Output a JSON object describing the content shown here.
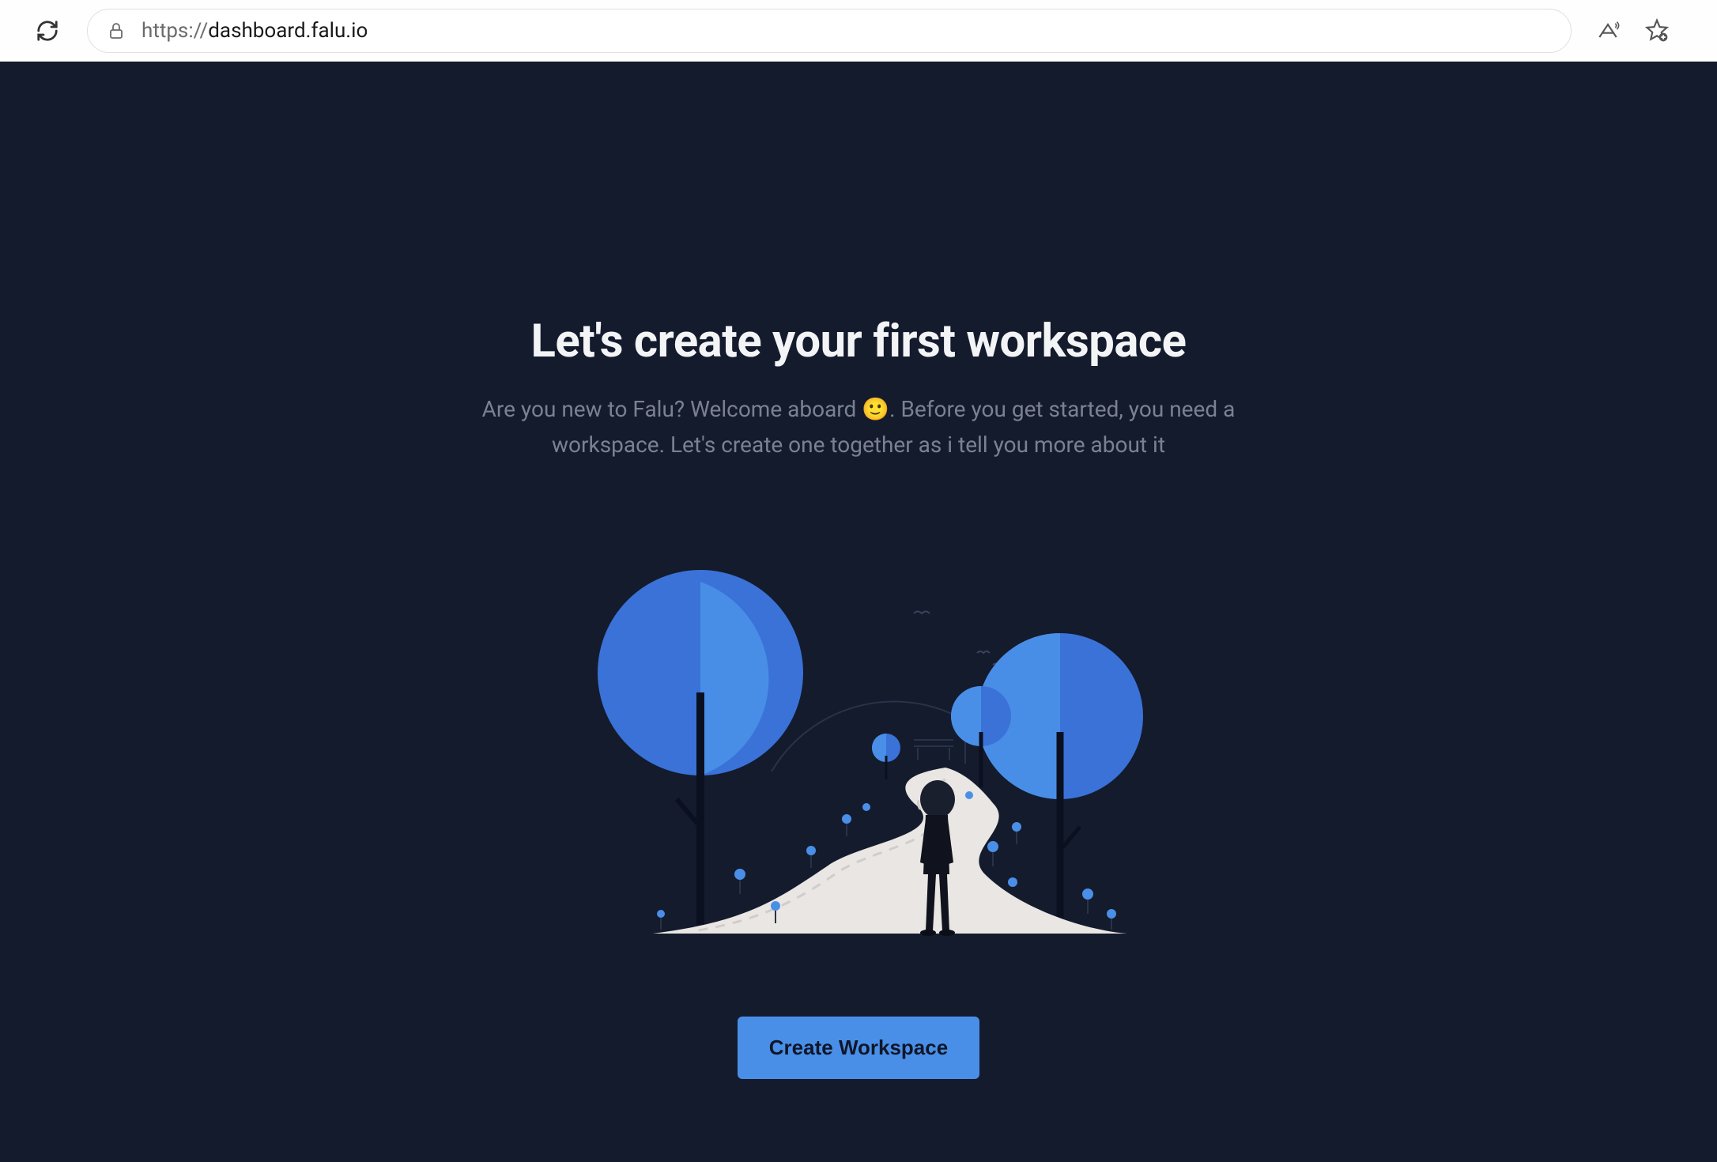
{
  "browser": {
    "url_prefix": "https://",
    "url_domain": "dashboard.falu.io"
  },
  "page": {
    "title": "Let's create your first workspace",
    "subtitle": "Are you new to Falu? Welcome aboard 🙂. Before you get started, you need a workspace. Let's create one together as i tell you more about it",
    "create_button_label": "Create Workspace"
  },
  "colors": {
    "background": "#141B2D",
    "accent": "#4A8FE7",
    "text_primary": "#F3F4F6",
    "text_secondary": "#7B8193"
  }
}
